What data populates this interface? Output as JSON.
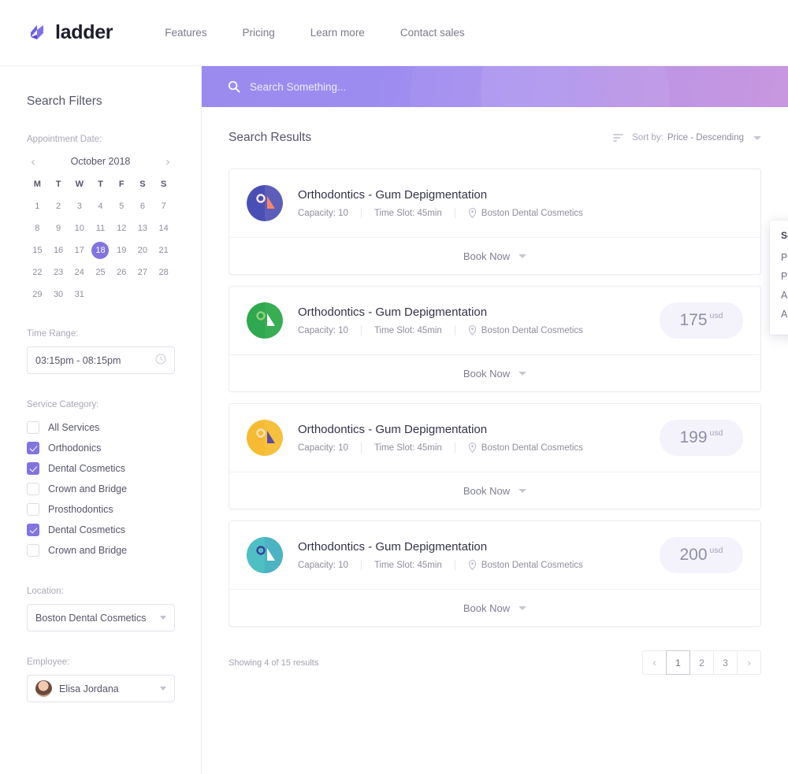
{
  "nav": {
    "brand": "ladder",
    "links": [
      "Features",
      "Pricing",
      "Learn more",
      "Contact sales"
    ]
  },
  "sidebar": {
    "title": "Search Filters",
    "appointment_date_label": "Appointment Date:",
    "calendar": {
      "month": "October 2018",
      "prev": "‹",
      "next": "›",
      "dow": [
        "M",
        "T",
        "W",
        "T",
        "F",
        "S",
        "S"
      ],
      "days": [
        1,
        2,
        3,
        4,
        5,
        6,
        7,
        8,
        9,
        10,
        11,
        12,
        13,
        14,
        15,
        16,
        17,
        18,
        19,
        20,
        21,
        22,
        23,
        24,
        25,
        26,
        27,
        28,
        29,
        30,
        31
      ],
      "selected": 18
    },
    "time_range_label": "Time Range:",
    "time_range_value": "03:15pm - 08:15pm",
    "service_category_label": "Service Category:",
    "services": [
      {
        "label": "All Services",
        "checked": false
      },
      {
        "label": "Orthodonics",
        "checked": true
      },
      {
        "label": "Dental Cosmetics",
        "checked": true
      },
      {
        "label": "Crown and Bridge",
        "checked": false
      },
      {
        "label": "Prosthodontics",
        "checked": false
      },
      {
        "label": "Dental Cosmetics",
        "checked": true
      },
      {
        "label": "Crown and Bridge",
        "checked": false
      }
    ],
    "location_label": "Location:",
    "location_value": "Boston Dental Cosmetics",
    "employee_label": "Employee:",
    "employee_value": "Elisa Jordana"
  },
  "search": {
    "placeholder": "Search Something..."
  },
  "results": {
    "title": "Search Results",
    "sort_label": "Sort by:",
    "sort_value": "Price - Descending",
    "sort_menu": {
      "title": "Sort by:",
      "options": [
        "Price Ascending",
        "Price Descending",
        "Appointment Capacity Ascending",
        "Appointment Capacity Descending"
      ]
    },
    "book_label": "Book Now",
    "items": [
      {
        "title": "Orthodontics - Gum Depigmentation",
        "capacity": "Capacity: 10",
        "time_slot": "Time Slot: 45min",
        "location": "Boston Dental Cosmetics",
        "price": "",
        "currency": "",
        "avatar_colors": [
          "#4a4fb5",
          "#fbe9e0",
          "#f4876c"
        ]
      },
      {
        "title": "Orthodontics - Gum Depigmentation",
        "capacity": "Capacity: 10",
        "time_slot": "Time Slot: 45min",
        "location": "Boston Dental Cosmetics",
        "price": "175",
        "currency": "usd",
        "avatar_colors": [
          "#2fa84f",
          "#8fd27a",
          "#ffffff"
        ]
      },
      {
        "title": "Orthodontics - Gum Depigmentation",
        "capacity": "Capacity: 10",
        "time_slot": "Time Slot: 45min",
        "location": "Boston Dental Cosmetics",
        "price": "199",
        "currency": "usd",
        "avatar_colors": [
          "#f6bb32",
          "#f6e3bb",
          "#5b4b9e"
        ]
      },
      {
        "title": "Orthodontics - Gum Depigmentation",
        "capacity": "Capacity: 10",
        "time_slot": "Time Slot: 45min",
        "location": "Boston Dental Cosmetics",
        "price": "200",
        "currency": "usd",
        "avatar_colors": [
          "#4ec0c4",
          "#3a3f9e",
          "#ffffff"
        ]
      }
    ],
    "showing": "Showing 4 of 15 results",
    "pagination": {
      "prev": "‹",
      "next": "›",
      "pages": [
        "1",
        "2",
        "3"
      ],
      "active": "1"
    }
  },
  "colors": {
    "accent": "#8274e0",
    "brand": "#6c5ce7",
    "gradient_start": "#9b8bef",
    "gradient_end": "#c490dd"
  }
}
